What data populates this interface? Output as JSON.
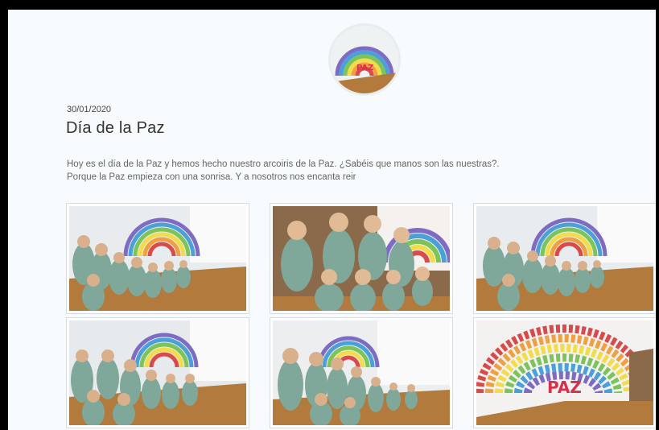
{
  "post": {
    "date": "30/01/2020",
    "title": "Día de la Paz",
    "paragraphs": [
      "Hoy es el día de la Paz y hemos hecho nuestro arcoiris de la Paz. ¿Sabéis que manos son las nuestras?.",
      "Porque la Paz empieza con una sonrisa. Y a nosotros nos encanta reir"
    ]
  },
  "cover": {
    "text": "PAZ"
  },
  "gallery": [
    {
      "kind": "group-left"
    },
    {
      "kind": "group-close"
    },
    {
      "kind": "group-left"
    },
    {
      "kind": "group-wide"
    },
    {
      "kind": "group-standing"
    },
    {
      "kind": "rainbow",
      "text": "PAZ"
    }
  ],
  "colors": {
    "background": "#f7fbfd",
    "rainbow": [
      "#d94a4a",
      "#f0a040",
      "#f2dc4a",
      "#7cc45a",
      "#4aa0d8",
      "#7e6bc4"
    ],
    "uniform": "#7fa89a",
    "floor": "#b27a3c"
  }
}
